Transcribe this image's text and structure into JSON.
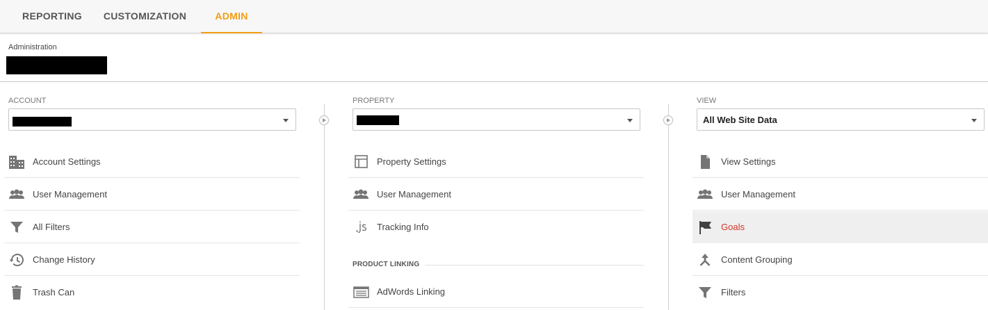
{
  "tabs": [
    {
      "label": "REPORTING",
      "active": false
    },
    {
      "label": "CUSTOMIZATION",
      "active": false
    },
    {
      "label": "ADMIN",
      "active": true
    }
  ],
  "colors": {
    "accent": "#f39c12",
    "selected_text": "#d93025",
    "icon": "#757575"
  },
  "header": {
    "title": "Administration"
  },
  "account": {
    "label": "ACCOUNT",
    "items": [
      {
        "label": "Account Settings",
        "icon": "building-icon"
      },
      {
        "label": "User Management",
        "icon": "users-icon"
      },
      {
        "label": "All Filters",
        "icon": "filter-icon"
      },
      {
        "label": "Change History",
        "icon": "history-icon"
      },
      {
        "label": "Trash Can",
        "icon": "trash-icon"
      }
    ]
  },
  "property": {
    "label": "PROPERTY",
    "items": [
      {
        "label": "Property Settings",
        "icon": "layout-icon"
      },
      {
        "label": "User Management",
        "icon": "users-icon"
      },
      {
        "label": "Tracking Info",
        "icon": "js-icon"
      }
    ],
    "linking": {
      "label": "PRODUCT LINKING",
      "items": [
        {
          "label": "AdWords Linking",
          "icon": "adwords-icon"
        }
      ]
    }
  },
  "view": {
    "label": "VIEW",
    "selected": "All Web Site Data",
    "items": [
      {
        "label": "View Settings",
        "icon": "document-icon"
      },
      {
        "label": "User Management",
        "icon": "users-icon"
      },
      {
        "label": "Goals",
        "icon": "flag-icon",
        "selected": true
      },
      {
        "label": "Content Grouping",
        "icon": "grouping-icon"
      },
      {
        "label": "Filters",
        "icon": "filter-icon"
      }
    ]
  }
}
